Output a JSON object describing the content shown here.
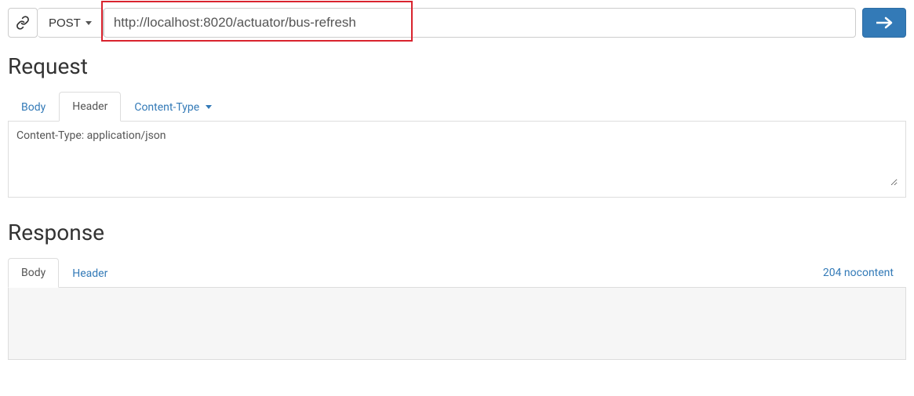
{
  "topbar": {
    "method": "POST",
    "url": "http://localhost:8020/actuator/bus-refresh"
  },
  "request": {
    "heading": "Request",
    "tabs": {
      "body": "Body",
      "header": "Header",
      "content_type": "Content-Type"
    },
    "header_content": "Content-Type: application/json"
  },
  "response": {
    "heading": "Response",
    "tabs": {
      "body": "Body",
      "header": "Header"
    },
    "status": "204 nocontent"
  }
}
